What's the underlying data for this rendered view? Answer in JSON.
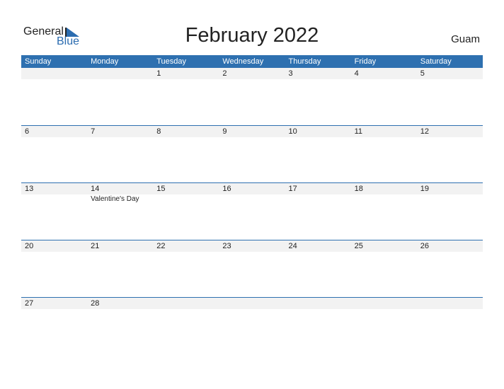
{
  "logo": {
    "general": "General",
    "blue": "Blue"
  },
  "title": "February 2022",
  "region": "Guam",
  "weekdays": [
    "Sunday",
    "Monday",
    "Tuesday",
    "Wednesday",
    "Thursday",
    "Friday",
    "Saturday"
  ],
  "weeks": [
    {
      "days": [
        "",
        "",
        "1",
        "2",
        "3",
        "4",
        "5"
      ],
      "events": [
        "",
        "",
        "",
        "",
        "",
        "",
        ""
      ]
    },
    {
      "days": [
        "6",
        "7",
        "8",
        "9",
        "10",
        "11",
        "12"
      ],
      "events": [
        "",
        "",
        "",
        "",
        "",
        "",
        ""
      ]
    },
    {
      "days": [
        "13",
        "14",
        "15",
        "16",
        "17",
        "18",
        "19"
      ],
      "events": [
        "",
        "Valentine's Day",
        "",
        "",
        "",
        "",
        ""
      ]
    },
    {
      "days": [
        "20",
        "21",
        "22",
        "23",
        "24",
        "25",
        "26"
      ],
      "events": [
        "",
        "",
        "",
        "",
        "",
        "",
        ""
      ]
    },
    {
      "days": [
        "27",
        "28",
        "",
        "",
        "",
        "",
        ""
      ],
      "events": [
        "",
        "",
        "",
        "",
        "",
        "",
        ""
      ]
    }
  ],
  "colors": {
    "accent": "#2e70b0",
    "strip": "#f2f2f2"
  }
}
